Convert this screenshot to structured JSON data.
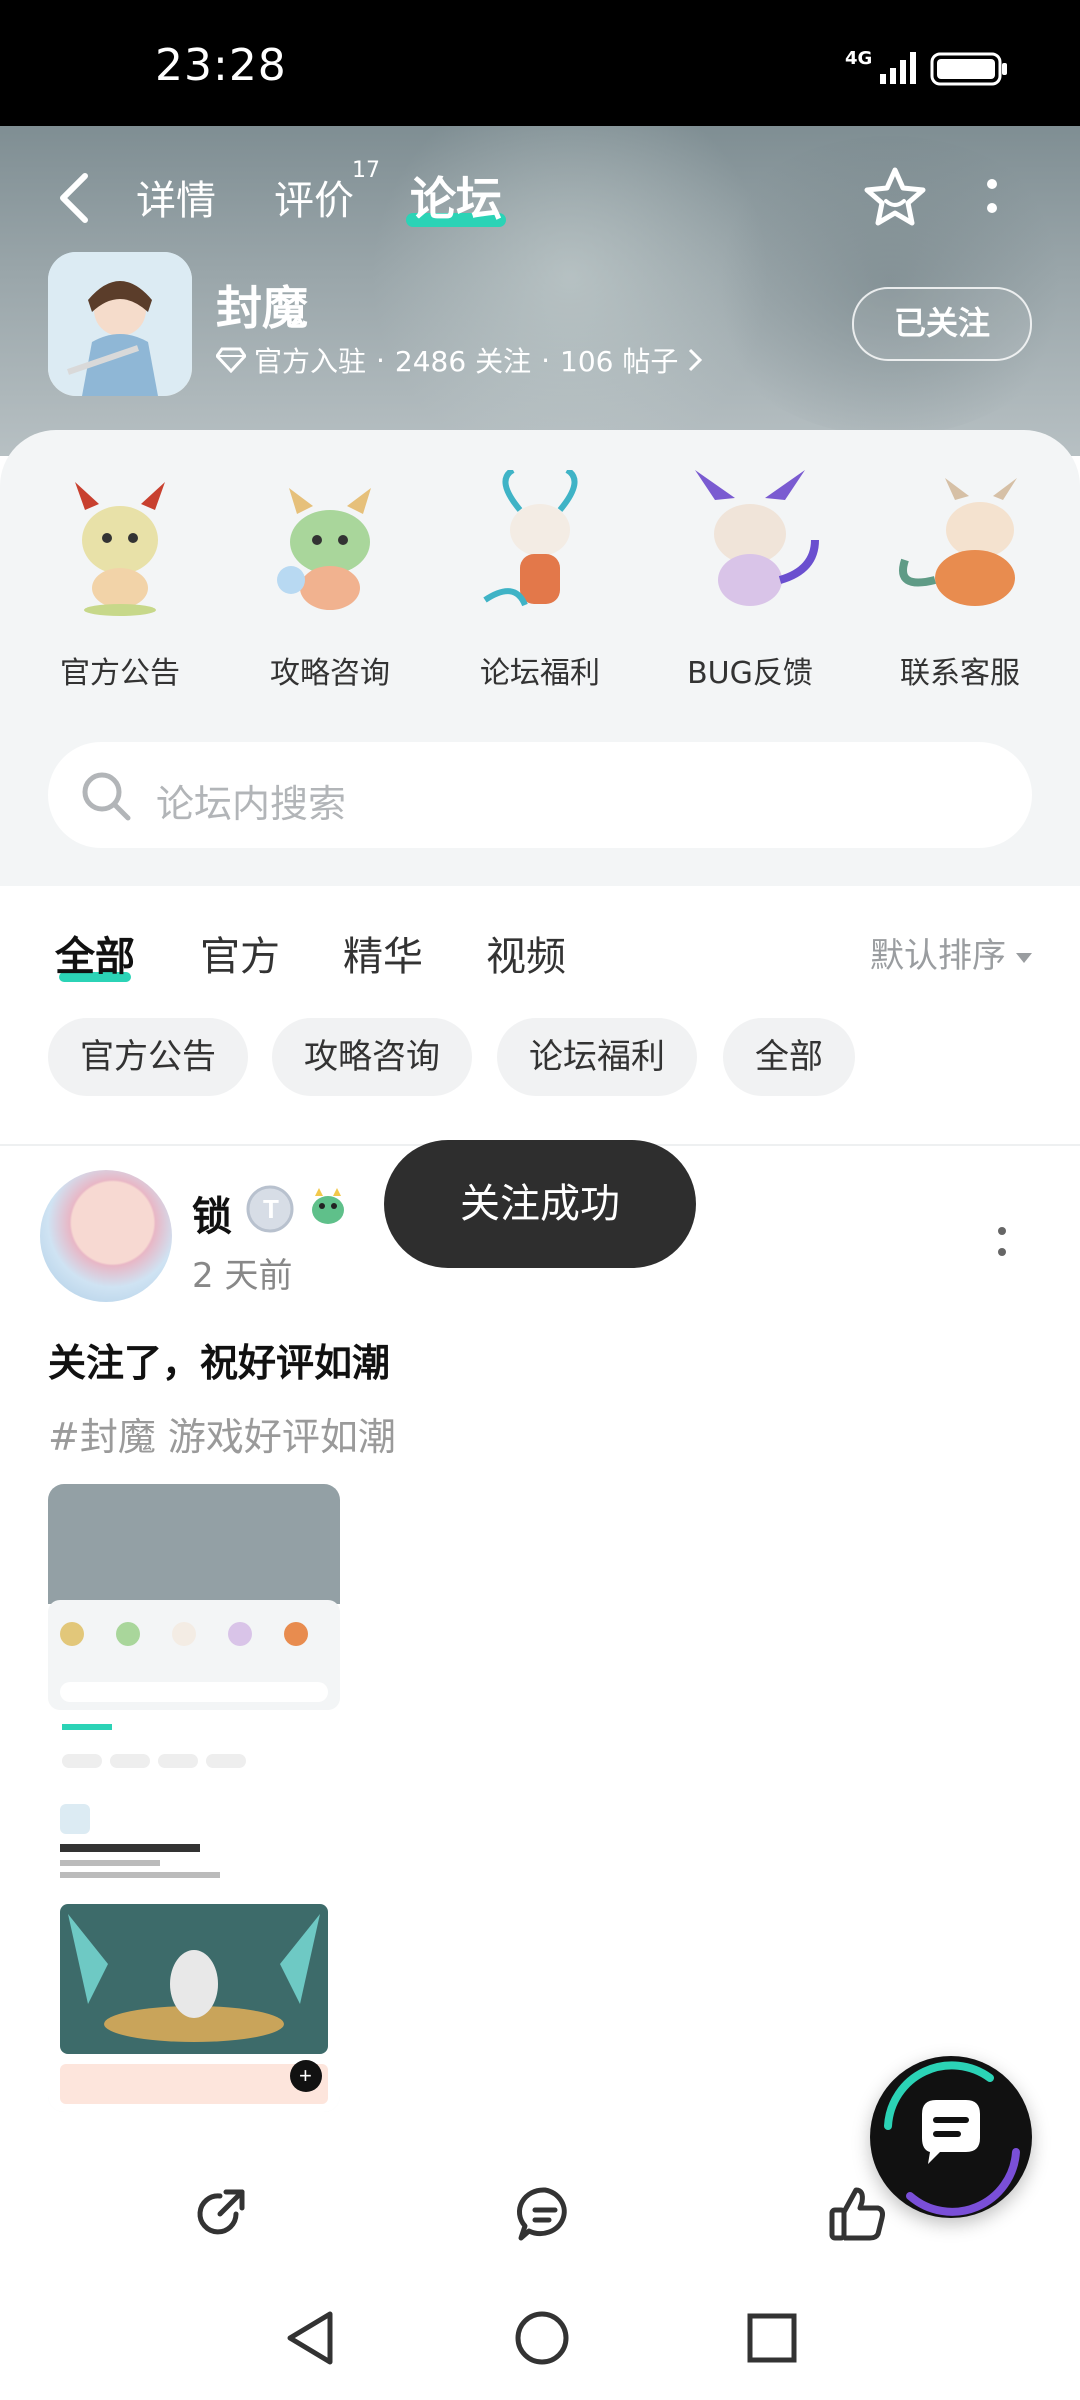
{
  "status_bar": {
    "time": "23:28",
    "network": "4G"
  },
  "header": {
    "tabs": [
      {
        "label": "详情"
      },
      {
        "label": "评价",
        "badge": "17"
      },
      {
        "label": "论坛",
        "active": true
      }
    ],
    "app": {
      "name": "封魔",
      "official": "官方入驻",
      "followers": "2486 关注",
      "posts": "106 帖子",
      "sep": "·",
      "follow_label": "已关注"
    }
  },
  "categories": [
    {
      "label": "官方公告"
    },
    {
      "label": "攻略咨询"
    },
    {
      "label": "论坛福利"
    },
    {
      "label": "BUG反馈"
    },
    {
      "label": "联系客服"
    }
  ],
  "search": {
    "placeholder": "论坛内搜索"
  },
  "feed_tabs": [
    {
      "label": "全部",
      "active": true
    },
    {
      "label": "官方"
    },
    {
      "label": "精华"
    },
    {
      "label": "视频"
    }
  ],
  "sort": {
    "label": "默认排序"
  },
  "chips": [
    {
      "label": "官方公告"
    },
    {
      "label": "攻略咨询"
    },
    {
      "label": "论坛福利"
    },
    {
      "label": "全部"
    }
  ],
  "post": {
    "author": "锁",
    "time": "2 天前",
    "title": "关注了，祝好评如潮",
    "tag": "#封魔 游戏好评如潮"
  },
  "toast": {
    "text": "关注成功"
  },
  "colors": {
    "accent": "#2bd3b6",
    "toast_bg": "#2e2e2e",
    "panel_bg": "#f3f5f6"
  },
  "icons": {
    "back": "back-icon",
    "star": "star-icon",
    "more": "more-vertical-icon",
    "search": "search-icon",
    "share": "share-icon",
    "comment": "comment-icon",
    "like": "like-icon",
    "chat": "chat-float-icon"
  }
}
